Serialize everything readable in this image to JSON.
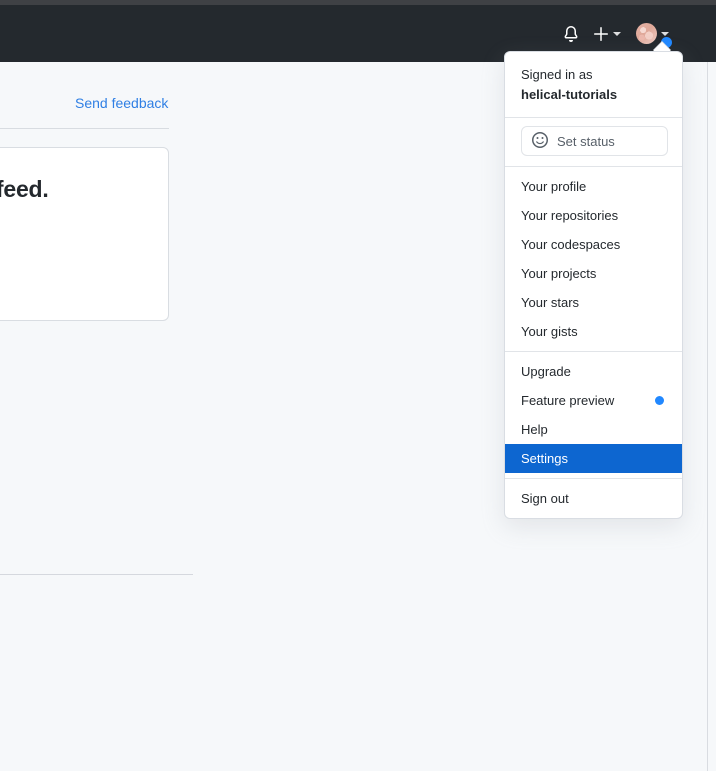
{
  "header": {
    "notifications_icon": "bell-icon",
    "create_new_icon": "plus-icon",
    "avatar_icon": "avatar",
    "has_notification_dot": true,
    "background_color": "#24292e"
  },
  "page": {
    "feedback_link": "Send feedback",
    "news_card_text": "news feed.",
    "background_color": "#f6f8fa"
  },
  "dropdown": {
    "signed_in_label": "Signed in as",
    "username": "helical-tutorials",
    "set_status": {
      "label": "Set status",
      "icon": "smiley-icon"
    },
    "groups": [
      {
        "items": [
          {
            "label": "Your profile"
          },
          {
            "label": "Your repositories"
          },
          {
            "label": "Your codespaces"
          },
          {
            "label": "Your projects"
          },
          {
            "label": "Your stars"
          },
          {
            "label": "Your gists"
          }
        ]
      },
      {
        "items": [
          {
            "label": "Upgrade"
          },
          {
            "label": "Feature preview",
            "badge": "blue-dot"
          },
          {
            "label": "Help"
          },
          {
            "label": "Settings",
            "selected": true
          }
        ]
      },
      {
        "items": [
          {
            "label": "Sign out"
          }
        ]
      }
    ],
    "selected_item": "Settings",
    "highlight_color": "#0d66d0",
    "badge_color": "#2188ff"
  }
}
